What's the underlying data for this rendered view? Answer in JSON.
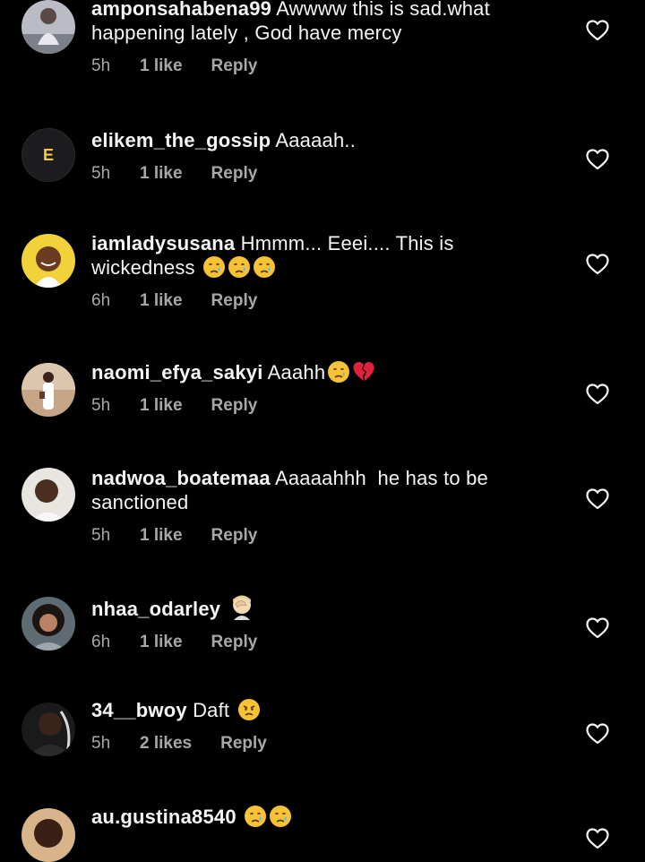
{
  "comments": [
    {
      "username": "amponsahabena99",
      "text": "Awwww this is sad.what happening lately , God have mercy",
      "time": "5h",
      "likes": "1 like",
      "reply": "Reply"
    },
    {
      "username": "elikem_the_gossip",
      "text": "Aaaaah..",
      "avatar_letter": "E",
      "time": "5h",
      "likes": "1 like",
      "reply": "Reply"
    },
    {
      "username": "iamladysusana",
      "text": "Hmmm... Eeei.... This is wickedness",
      "emojis": [
        "crying-face-emoji",
        "crying-face-emoji",
        "crying-face-emoji"
      ],
      "time": "6h",
      "likes": "1 like",
      "reply": "Reply"
    },
    {
      "username": "naomi_efya_sakyi",
      "text": "Aaahh",
      "emojis": [
        "crying-face-emoji",
        "broken-heart-emoji"
      ],
      "time": "5h",
      "likes": "1 like",
      "reply": "Reply"
    },
    {
      "username": "nadwoa_boatemaa",
      "text": "Aaaaahhh  he has to be sanctioned",
      "time": "5h",
      "likes": "1 like",
      "reply": "Reply"
    },
    {
      "username": "nhaa_odarley",
      "text": "",
      "emojis": [
        "facepalm-emoji"
      ],
      "time": "6h",
      "likes": "1 like",
      "reply": "Reply"
    },
    {
      "username": "34__bwoy",
      "text": "Daft",
      "emojis": [
        "angry-face-emoji"
      ],
      "time": "5h",
      "likes": "2 likes",
      "reply": "Reply"
    },
    {
      "username": "au.gustina8540",
      "text": "",
      "emojis": [
        "crying-face-emoji",
        "crying-face-emoji"
      ]
    }
  ],
  "colors": {
    "background": "#000000",
    "text": "#f5f5f5",
    "meta": "#a8a8a8"
  }
}
